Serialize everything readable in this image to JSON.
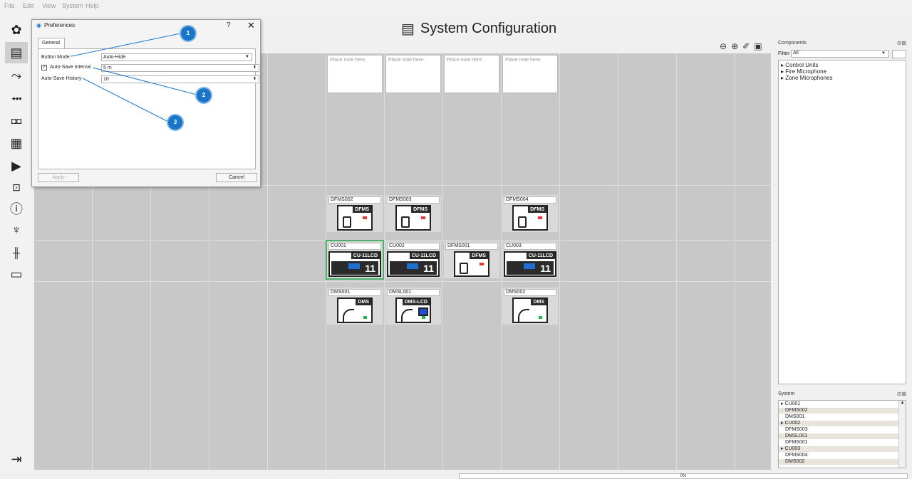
{
  "menu": [
    "File",
    "Edit",
    "View",
    "System",
    "Help"
  ],
  "title": "System Configuration",
  "toolbar_icons": [
    "gear-icon",
    "server-icon",
    "route-icon",
    "speaker-group-icon",
    "dual-box-icon",
    "grid-icon",
    "media-icon",
    "device-settings-icon",
    "info-icon",
    "mic-settings-icon",
    "audio-matrix-icon",
    "document-icon",
    "exit-icon"
  ],
  "preferences": {
    "title": "Preferences",
    "help": "?",
    "close": "✕",
    "tab": "General",
    "button_mode_label": "Button Mode:",
    "button_mode_value": "Auto-Hide",
    "auto_save_interval_label": "Auto-Save Interval",
    "auto_save_interval_checked": true,
    "auto_save_interval_value": "5 m",
    "auto_save_history_label": "Auto-Save History",
    "auto_save_history_value": "10",
    "apply": "Apply",
    "cancel": "Cancel"
  },
  "callouts": [
    "1",
    "2",
    "3"
  ],
  "notes": [
    "Place note here.",
    "Place note here.",
    "Place note here.",
    "Place note here."
  ],
  "devices": {
    "dfms002": {
      "label": "DFMS002",
      "model": "DFMS"
    },
    "dfms003": {
      "label": "DFMS003",
      "model": "DFMS"
    },
    "dfms004": {
      "label": "DFMS004",
      "model": "DFMS"
    },
    "cu001": {
      "label": "CU001",
      "model": "CU-11LCD",
      "num": "11"
    },
    "cu002": {
      "label": "CU002",
      "model": "CU-11LCD",
      "num": "11"
    },
    "dfms001": {
      "label": "DFMS001",
      "model": "DFMS"
    },
    "cu003": {
      "label": "CU003",
      "model": "CU-11LCD",
      "num": "11"
    },
    "dms001": {
      "label": "DMS001",
      "model": "DMS"
    },
    "dmsl001": {
      "label": "DMSL001",
      "model": "DMS-LCD"
    },
    "dms002": {
      "label": "DMS002",
      "model": "DMS"
    }
  },
  "components": {
    "title": "Components",
    "filter_label": "Filter:",
    "filter_value": "All",
    "items": [
      "Control Units",
      "Fire Microphone",
      "Zone Microphones"
    ]
  },
  "system": {
    "title": "System",
    "items": [
      "CU001",
      "DFMS002",
      "DMS001",
      "CU002",
      "DFMS003",
      "DMSL001",
      "DFMS001",
      "CU003",
      "DFMS004",
      "DMS002"
    ]
  },
  "status_text": "0%",
  "colors": {
    "accent": "#1a75c8",
    "selected": "#4caf6a",
    "canvas": "#c8c8c8"
  }
}
